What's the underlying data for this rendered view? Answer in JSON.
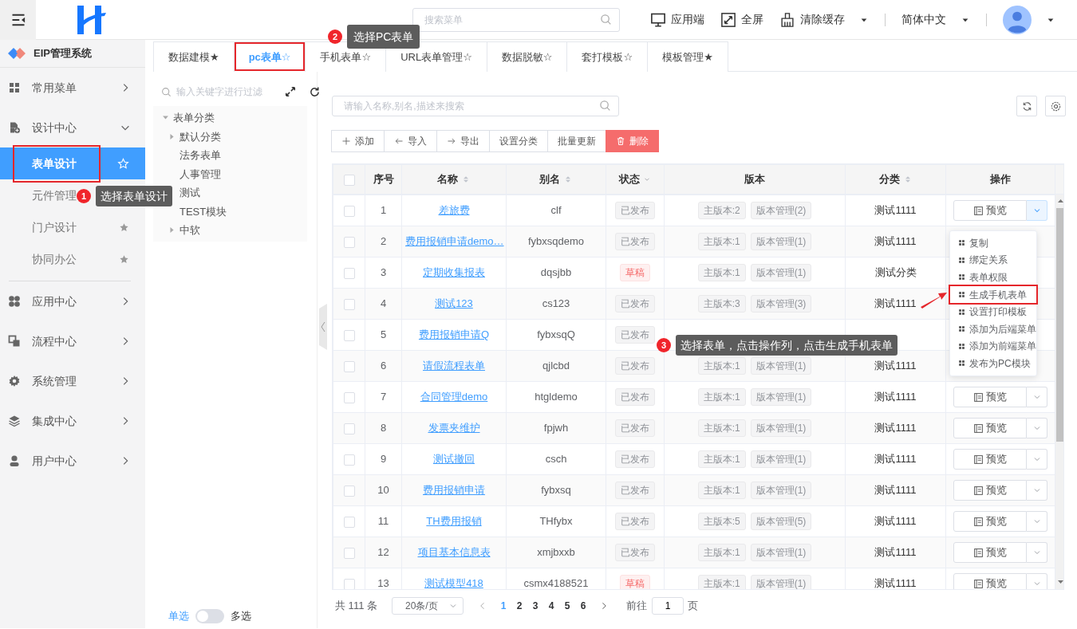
{
  "topbar": {
    "search_placeholder": "搜索菜单",
    "actions": [
      {
        "label": "应用端",
        "kind": "monitor",
        "dropdown": false
      },
      {
        "label": "全屏",
        "kind": "fullscreen",
        "dropdown": false
      },
      {
        "label": "清除缓存",
        "kind": "broom",
        "dropdown": true
      }
    ],
    "language": "简体中文"
  },
  "sidebar": {
    "title": "EIP管理系统",
    "groups": [
      {
        "label": "常用菜单",
        "kind": "grid",
        "expanded": false
      },
      {
        "label": "设计中心",
        "kind": "design",
        "expanded": true,
        "children": [
          {
            "label": "表单设计",
            "selected": true,
            "marked": true,
            "star_filled": false
          },
          {
            "label": "元件管理",
            "selected": false,
            "marked": false
          },
          {
            "label": "门户设计",
            "selected": false,
            "marked": false,
            "star_filled": true
          },
          {
            "label": "协同办公",
            "selected": false,
            "marked": false,
            "star_filled": true
          }
        ]
      },
      {
        "label": "应用中心",
        "kind": "apps",
        "expanded": false
      },
      {
        "label": "流程中心",
        "kind": "flow",
        "expanded": false
      },
      {
        "label": "系统管理",
        "kind": "gear",
        "expanded": false
      },
      {
        "label": "集成中心",
        "kind": "layers",
        "expanded": false
      },
      {
        "label": "用户中心",
        "kind": "user",
        "expanded": false
      }
    ]
  },
  "tabs": [
    {
      "label": "数据建模★",
      "selected": false,
      "marked": false
    },
    {
      "label": "pc表单☆",
      "selected": true,
      "marked": true
    },
    {
      "label": "手机表单☆",
      "selected": false,
      "marked": false
    },
    {
      "label": "URL表单管理☆",
      "selected": false,
      "marked": false
    },
    {
      "label": "数据脱敏☆",
      "selected": false,
      "marked": false
    },
    {
      "label": "套打模板☆",
      "selected": false,
      "marked": false
    },
    {
      "label": "模板管理★",
      "selected": false,
      "marked": false
    }
  ],
  "tree": {
    "placeholder": "输入关键字进行过滤",
    "nodes": [
      {
        "label": "表单分类",
        "expanded": true,
        "children": [
          {
            "label": "默认分类",
            "expanded": false
          },
          {
            "label": "法务表单"
          },
          {
            "label": "人事管理"
          },
          {
            "label": "测试"
          },
          {
            "label": "TEST模块"
          },
          {
            "label": "中软",
            "expanded": false
          }
        ]
      }
    ],
    "select_mode": {
      "left": "单选",
      "right": "多选",
      "on": false
    }
  },
  "main": {
    "search_placeholder": "请输入名称,别名,描述来搜索",
    "toolbar": [
      {
        "label": "添加",
        "kind": "add"
      },
      {
        "label": "导入",
        "kind": "import"
      },
      {
        "label": "导出",
        "kind": "export"
      },
      {
        "label": "设置分类",
        "kind": "plain"
      },
      {
        "label": "批量更新",
        "kind": "plain"
      },
      {
        "label": "删除",
        "kind": "delete"
      }
    ]
  },
  "table": {
    "header_checked": false,
    "columns": [
      {
        "label": "序号",
        "sortable": false,
        "filter": false
      },
      {
        "label": "名称",
        "sortable": true,
        "filter": false
      },
      {
        "label": "别名",
        "sortable": true,
        "filter": false
      },
      {
        "label": "状态",
        "sortable": false,
        "filter": true
      },
      {
        "label": "版本",
        "sortable": false,
        "filter": false
      },
      {
        "label": "分类",
        "sortable": true,
        "filter": false
      },
      {
        "label": "操作",
        "sortable": false,
        "filter": false
      }
    ],
    "rows": [
      {
        "checked": false,
        "menu_open": true,
        "index": "1",
        "name": "差旅费",
        "alias": "clf",
        "status": "已发布",
        "draft": false,
        "main_version": "主版本:2",
        "versions": "版本管理(2)",
        "category": "测试1111",
        "preview": "预览"
      },
      {
        "checked": false,
        "index": "2",
        "name": "费用报销申请demo…",
        "alias": "fybxsqdemo",
        "status": "已发布",
        "draft": false,
        "main_version": "主版本:1",
        "versions": "版本管理(1)",
        "category": "测试1111"
      },
      {
        "checked": false,
        "index": "3",
        "name": "定期收集报表",
        "alias": "dqsjbb",
        "status": "草稿",
        "draft": true,
        "main_version": "主版本:1",
        "versions": "版本管理(1)",
        "category": "测试分类"
      },
      {
        "checked": false,
        "index": "4",
        "name": "测试123",
        "alias": "cs123",
        "status": "已发布",
        "draft": false,
        "main_version": "主版本:3",
        "versions": "版本管理(3)",
        "category": "测试1111"
      },
      {
        "checked": false,
        "index": "5",
        "name": "费用报销申请Q",
        "alias": "fybxsqQ",
        "status": "已发布",
        "draft": false
      },
      {
        "checked": false,
        "index": "6",
        "name": "请假流程表单",
        "alias": "qjlcbd",
        "status": "已发布",
        "draft": false,
        "main_version": "主版本:1",
        "versions": "版本管理(1)",
        "category": "测试1111"
      },
      {
        "checked": false,
        "index": "7",
        "name": "合同管理demo",
        "alias": "htgldemo",
        "status": "已发布",
        "draft": false,
        "main_version": "主版本:1",
        "versions": "版本管理(1)",
        "category": "测试1111",
        "preview": "预览"
      },
      {
        "checked": false,
        "index": "8",
        "name": "发票夹维护",
        "alias": "fpjwh",
        "status": "已发布",
        "draft": false,
        "main_version": "主版本:1",
        "versions": "版本管理(1)",
        "category": "测试1111",
        "preview": "预览"
      },
      {
        "checked": false,
        "index": "9",
        "name": "测试撤回",
        "alias": "csch",
        "status": "已发布",
        "draft": false,
        "main_version": "主版本:1",
        "versions": "版本管理(1)",
        "category": "测试1111",
        "preview": "预览"
      },
      {
        "checked": false,
        "index": "10",
        "name": "费用报销申请",
        "alias": "fybxsq",
        "status": "已发布",
        "draft": false,
        "main_version": "主版本:1",
        "versions": "版本管理(1)",
        "category": "测试1111",
        "preview": "预览"
      },
      {
        "checked": false,
        "index": "11",
        "name": "TH费用报销",
        "alias": "THfybx",
        "status": "已发布",
        "draft": false,
        "main_version": "主版本:5",
        "versions": "版本管理(5)",
        "category": "测试1111",
        "preview": "预览"
      },
      {
        "checked": false,
        "index": "12",
        "name": "项目基本信息表",
        "alias": "xmjbxxb",
        "status": "已发布",
        "draft": false,
        "main_version": "主版本:1",
        "versions": "版本管理(1)",
        "category": "测试1111",
        "preview": "预览"
      },
      {
        "checked": false,
        "index": "13",
        "name": "测试模型418",
        "alias": "csmx4188521",
        "status": "草稿",
        "draft": true,
        "main_version": "主版本:1",
        "versions": "版本管理(1)",
        "category": "测试1111",
        "preview": "预览"
      }
    ]
  },
  "action_menu": [
    {
      "label": "复制",
      "marked": false
    },
    {
      "label": "绑定关系",
      "marked": false
    },
    {
      "label": "表单权限",
      "marked": false
    },
    {
      "label": "生成手机表单",
      "marked": true
    },
    {
      "label": "设置打印模板",
      "marked": false
    },
    {
      "label": "添加为后端菜单",
      "marked": false
    },
    {
      "label": "添加为前端菜单",
      "marked": false
    },
    {
      "label": "发布为PC模块",
      "marked": false
    }
  ],
  "pagination": {
    "total": "共 111 条",
    "page_size": "20条/页",
    "pages": [
      {
        "label": "1",
        "selected": true
      },
      {
        "label": "2",
        "selected": false
      },
      {
        "label": "3",
        "selected": false
      },
      {
        "label": "4",
        "selected": false
      },
      {
        "label": "5",
        "selected": false
      },
      {
        "label": "6",
        "selected": false
      }
    ],
    "goto_label": "前往",
    "goto_value": "1",
    "page_unit": "页"
  },
  "callouts": [
    {
      "number": "1",
      "text": "选择表单设计"
    },
    {
      "number": "2",
      "text": "选择PC表单"
    },
    {
      "number": "3",
      "text": "选择表单，点击操作列，点击生成手机表单"
    }
  ]
}
